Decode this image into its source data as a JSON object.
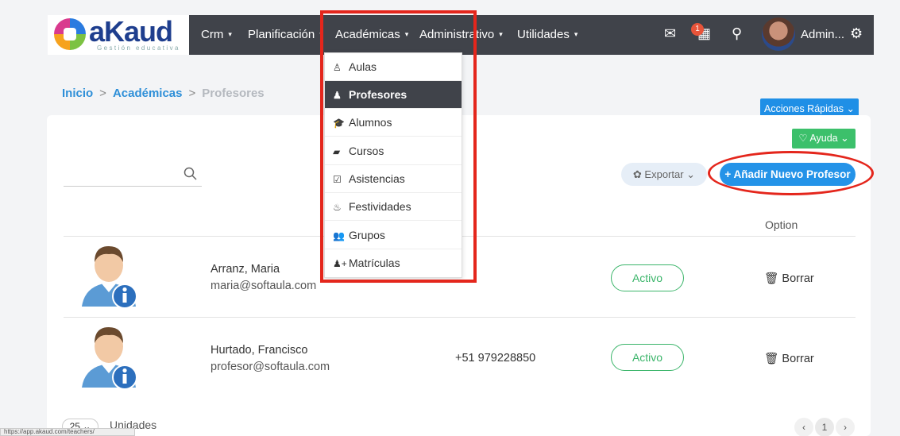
{
  "brand": {
    "name": "aKaud",
    "tagline": "Gestión educativa"
  },
  "nav": {
    "items": [
      {
        "label": "Crm",
        "caret": "▾"
      },
      {
        "label": "Planificación",
        "caret": "▾"
      },
      {
        "label": "Académicas",
        "caret": "▾"
      },
      {
        "label": "Administrativo",
        "caret": "▾"
      },
      {
        "label": "Utilidades",
        "caret": "▾"
      }
    ],
    "notification_count": "1",
    "user_name": "Admin...",
    "icons": {
      "mail": "✉",
      "calendar": "▦",
      "search": "⚲",
      "settings": "⚙"
    }
  },
  "dropdown": {
    "items": [
      {
        "label": "Aulas",
        "icon": "♙",
        "active": false
      },
      {
        "label": "Profesores",
        "icon": "♟",
        "active": true
      },
      {
        "label": "Alumnos",
        "icon": "🎓",
        "active": false
      },
      {
        "label": "Cursos",
        "icon": "▰",
        "active": false
      },
      {
        "label": "Asistencias",
        "icon": "☑",
        "active": false
      },
      {
        "label": "Festividades",
        "icon": "♨",
        "active": false
      },
      {
        "label": "Grupos",
        "icon": "👥",
        "active": false
      },
      {
        "label": "Matrículas",
        "icon": "♟+",
        "active": false
      }
    ]
  },
  "breadcrumb": {
    "home": "Inicio",
    "section": "Académicas",
    "current": "Profesores",
    "separator": ">"
  },
  "actions": {
    "quick": "Acciones Rápidas ⌄",
    "help": "♡ Ayuda ⌄",
    "export": "✿ Exportar ⌄",
    "add": "+ Añadir Nuevo Profesor"
  },
  "table": {
    "option_header": "Option",
    "rows": [
      {
        "name": "Arranz, Maria",
        "email": "maria@softaula.com",
        "phone": "",
        "status": "Activo",
        "delete": "🗑 Borrar"
      },
      {
        "name": "Hurtado, Francisco",
        "email": "profesor@softaula.com",
        "phone": "+51 979228850",
        "status": "Activo",
        "delete": "🗑 Borrar"
      }
    ]
  },
  "footer": {
    "per_page": "25 ⌄",
    "units_label": "Unidades",
    "prev": "‹",
    "page": "1",
    "next": "›",
    "status_url": "https://app.akaud.com/teachers/"
  },
  "colors": {
    "navbar": "#40434a",
    "primary": "#2493e8",
    "success": "#3bb56a",
    "highlight": "#e4261c"
  }
}
